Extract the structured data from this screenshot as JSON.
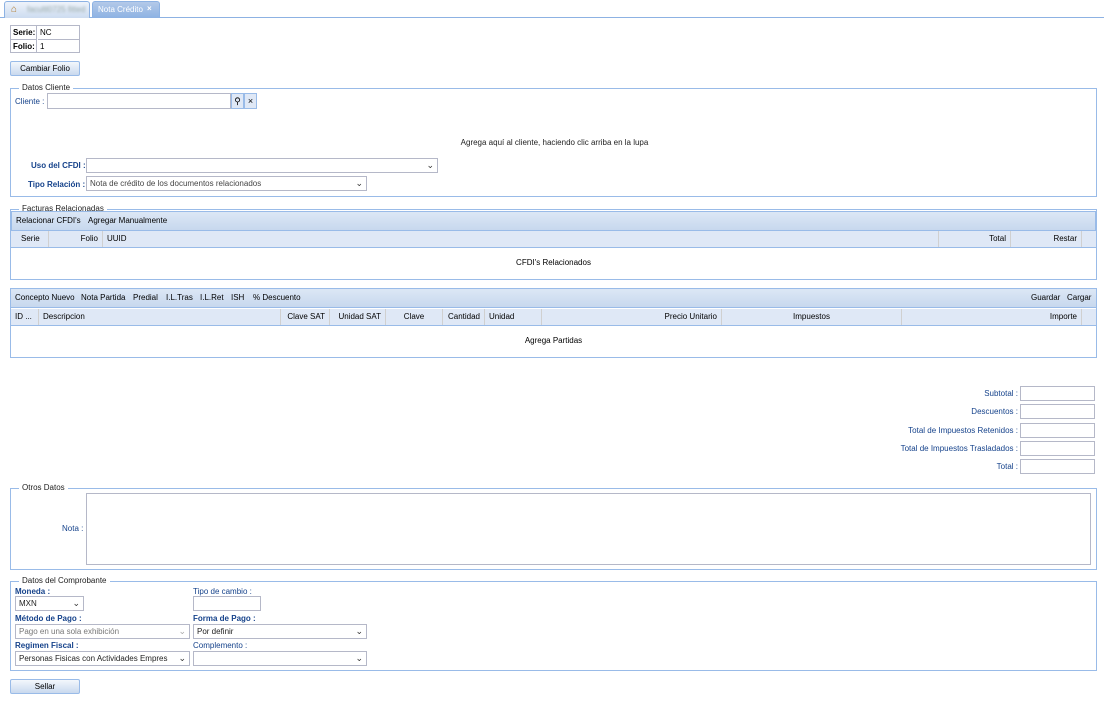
{
  "tabs": {
    "home_label": "facultl0725 fitted",
    "active_label": "Nota Crédito"
  },
  "folio": {
    "serie_label": "Serie:",
    "serie_value": "NC",
    "folio_label": "Folio:",
    "folio_value": "1"
  },
  "cambiar_folio_label": "Cambiar Folio",
  "cliente": {
    "legend": "Datos Cliente",
    "cliente_label": "Cliente :",
    "cliente_value": "",
    "hint": "Agrega aquí al cliente, haciendo clic arriba en la lupa",
    "uso_label": "Uso del CFDI :",
    "uso_value": "",
    "tipo_label": "Tipo Relación :",
    "tipo_value": "Nota de crédito de los documentos relacionados"
  },
  "facturas": {
    "legend": "Facturas Relacionadas",
    "toolbar": [
      "Relacionar CFDI's",
      "Agregar Manualmente"
    ],
    "columns": [
      "Serie",
      "Folio",
      "UUID",
      "Total",
      "Restar"
    ],
    "empty_text": "CFDI's Relacionados"
  },
  "partidas": {
    "toolbar_left": [
      "Concepto Nuevo",
      "Nota Partida",
      "Predial",
      "I.L.Tras",
      "I.L.Ret",
      "ISH",
      "% Descuento"
    ],
    "toolbar_right": [
      "Guardar",
      "Cargar"
    ],
    "columns": [
      "ID ...",
      "Descripcion",
      "Clave SAT",
      "Unidad SAT",
      "Clave",
      "Cantidad",
      "Unidad",
      "Precio Unitario",
      "Impuestos",
      "Importe"
    ],
    "empty_text": "Agrega Partidas"
  },
  "totales": {
    "subtotal_label": "Subtotal :",
    "descuentos_label": "Descuentos :",
    "retenidos_label": "Total de Impuestos Retenidos :",
    "trasladados_label": "Total de Impuestos Trasladados :",
    "total_label": "Total :"
  },
  "otros": {
    "legend": "Otros Datos",
    "nota_label": "Nota :",
    "nota_value": ""
  },
  "comprobante": {
    "legend": "Datos del Comprobante",
    "moneda_label": "Moneda :",
    "moneda_value": "MXN",
    "tipo_cambio_label": "Tipo de cambio :",
    "tipo_cambio_value": "",
    "metodo_label": "Método de Pago :",
    "metodo_value": "Pago en una sola exhibición",
    "forma_label": "Forma de Pago :",
    "forma_value": "Por definir",
    "regimen_label": "Regimen Fiscal :",
    "regimen_value": "Personas Fisicas con Actividades Empres",
    "complemento_label": "Complemento :",
    "complemento_value": ""
  },
  "sellar_label": "Sellar"
}
